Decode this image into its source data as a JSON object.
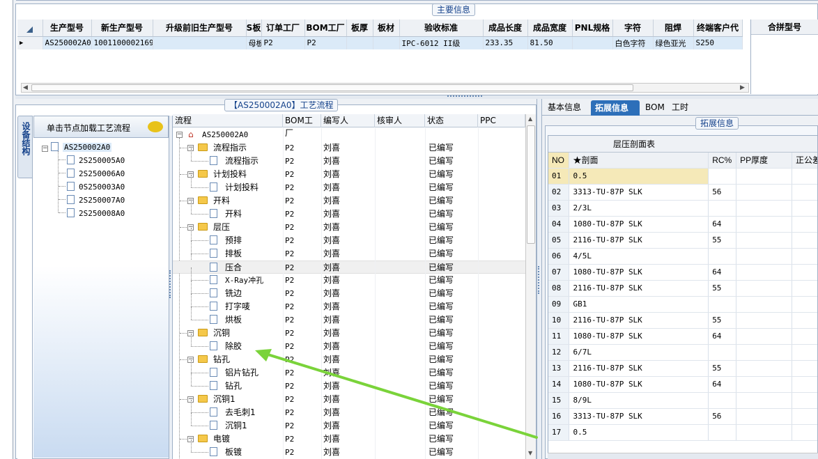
{
  "top": {
    "group_title": "主要信息",
    "columns": [
      "生产型号",
      "新生产型号",
      "升级前旧生产型号",
      "S板",
      "订单工厂",
      "BOM工厂",
      "板厚",
      "板材",
      "验收标准",
      "成品长度",
      "成品宽度",
      "PNL规格",
      "字符",
      "阻焊",
      "终端客户代"
    ],
    "row": [
      "AS250002A0",
      "10011000021699",
      "",
      "母板",
      "P2",
      "P2",
      "",
      "",
      "IPC-6012 II级",
      "233.35",
      "81.50",
      "",
      "白色字符",
      "绿色亚光",
      "S250"
    ],
    "right_header": "合拼型号"
  },
  "process": {
    "group_title": "【AS250002A0】工艺流程",
    "side_tab": "设备结构",
    "load_hint": "单击节点加载工艺流程",
    "left_tree": {
      "root": "AS250002A0",
      "children": [
        "2S250005A0",
        "2S250006A0",
        "0S250003A0",
        "2S250007A0",
        "2S250008A0"
      ]
    },
    "columns": [
      "流程",
      "BOM工厂",
      "编写人",
      "核审人",
      "状态",
      "PPC"
    ],
    "root": "AS250002A0",
    "rows": [
      {
        "name": "流程指示",
        "level": 1,
        "type": "folder",
        "factory": "P2",
        "writer": "刘喜",
        "status": "已编写"
      },
      {
        "name": "流程指示",
        "level": 2,
        "type": "doc",
        "factory": "P2",
        "writer": "刘喜",
        "status": "已编写"
      },
      {
        "name": "计划投料",
        "level": 1,
        "type": "folder",
        "factory": "P2",
        "writer": "刘喜",
        "status": "已编写"
      },
      {
        "name": "计划投料",
        "level": 2,
        "type": "doc",
        "factory": "P2",
        "writer": "刘喜",
        "status": "已编写"
      },
      {
        "name": "开料",
        "level": 1,
        "type": "folder",
        "factory": "P2",
        "writer": "刘喜",
        "status": "已编写"
      },
      {
        "name": "开料",
        "level": 2,
        "type": "doc",
        "factory": "P2",
        "writer": "刘喜",
        "status": "已编写"
      },
      {
        "name": "层压",
        "level": 1,
        "type": "folder",
        "factory": "P2",
        "writer": "刘喜",
        "status": "已编写"
      },
      {
        "name": "预排",
        "level": 2,
        "type": "doc",
        "factory": "P2",
        "writer": "刘喜",
        "status": "已编写"
      },
      {
        "name": "排板",
        "level": 2,
        "type": "doc",
        "factory": "P2",
        "writer": "刘喜",
        "status": "已编写"
      },
      {
        "name": "压合",
        "level": 2,
        "type": "doc",
        "factory": "P2",
        "writer": "刘喜",
        "status": "已编写",
        "selected": true
      },
      {
        "name": "X-Ray冲孔",
        "level": 2,
        "type": "doc",
        "factory": "P2",
        "writer": "刘喜",
        "status": "已编写"
      },
      {
        "name": "铣边",
        "level": 2,
        "type": "doc",
        "factory": "P2",
        "writer": "刘喜",
        "status": "已编写"
      },
      {
        "name": "打字唛",
        "level": 2,
        "type": "doc",
        "factory": "P2",
        "writer": "刘喜",
        "status": "已编写"
      },
      {
        "name": "烘板",
        "level": 2,
        "type": "doc",
        "factory": "P2",
        "writer": "刘喜",
        "status": "已编写"
      },
      {
        "name": "沉铜",
        "level": 1,
        "type": "folder",
        "factory": "P2",
        "writer": "刘喜",
        "status": "已编写"
      },
      {
        "name": "除胶",
        "level": 2,
        "type": "doc",
        "factory": "P2",
        "writer": "刘喜",
        "status": "已编写"
      },
      {
        "name": "钻孔",
        "level": 1,
        "type": "folder",
        "factory": "P2",
        "writer": "刘喜",
        "status": "已编写"
      },
      {
        "name": "铝片钻孔",
        "level": 2,
        "type": "doc",
        "factory": "P2",
        "writer": "刘喜",
        "status": "已编写"
      },
      {
        "name": "钻孔",
        "level": 2,
        "type": "doc",
        "factory": "P2",
        "writer": "刘喜",
        "status": "已编写"
      },
      {
        "name": "沉铜1",
        "level": 1,
        "type": "folder",
        "factory": "P2",
        "writer": "刘喜",
        "status": "已编写"
      },
      {
        "name": "去毛刺1",
        "level": 2,
        "type": "doc",
        "factory": "P2",
        "writer": "刘喜",
        "status": "已编写"
      },
      {
        "name": "沉铜1",
        "level": 2,
        "type": "doc",
        "factory": "P2",
        "writer": "刘喜",
        "status": "已编写"
      },
      {
        "name": "电镀",
        "level": 1,
        "type": "folder",
        "factory": "P2",
        "writer": "刘喜",
        "status": "已编写"
      },
      {
        "name": "板镀",
        "level": 2,
        "type": "doc",
        "factory": "P2",
        "writer": "刘喜",
        "status": "已编写"
      }
    ]
  },
  "right": {
    "tabs": [
      "基本信息",
      "拓展信息",
      "BOM",
      "工时"
    ],
    "active_tab": 1,
    "group_title": "拓展信息",
    "table_title": "层压剖面表",
    "columns": [
      "NO",
      "★剖面",
      "RC%",
      "PP厚度",
      "正公差"
    ],
    "rows": [
      [
        "01",
        "0.5",
        ""
      ],
      [
        "02",
        "3313-TU-87P SLK",
        "56"
      ],
      [
        "03",
        "2/3L",
        ""
      ],
      [
        "04",
        "1080-TU-87P SLK",
        "64"
      ],
      [
        "05",
        "2116-TU-87P SLK",
        "55"
      ],
      [
        "06",
        "4/5L",
        ""
      ],
      [
        "07",
        "1080-TU-87P SLK",
        "64"
      ],
      [
        "08",
        "2116-TU-87P SLK",
        "55"
      ],
      [
        "09",
        "GB1",
        ""
      ],
      [
        "10",
        "2116-TU-87P SLK",
        "55"
      ],
      [
        "11",
        "1080-TU-87P SLK",
        "64"
      ],
      [
        "12",
        "6/7L",
        ""
      ],
      [
        "13",
        "2116-TU-87P SLK",
        "55"
      ],
      [
        "14",
        "1080-TU-87P SLK",
        "64"
      ],
      [
        "15",
        "8/9L",
        ""
      ],
      [
        "16",
        "3313-TU-87P SLK",
        "56"
      ],
      [
        "17",
        "0.5",
        ""
      ]
    ]
  },
  "colors": {
    "accent_tab": "#2d6fb9",
    "selected_row": "#dbeaf8",
    "arrow": "#7ad33a"
  }
}
